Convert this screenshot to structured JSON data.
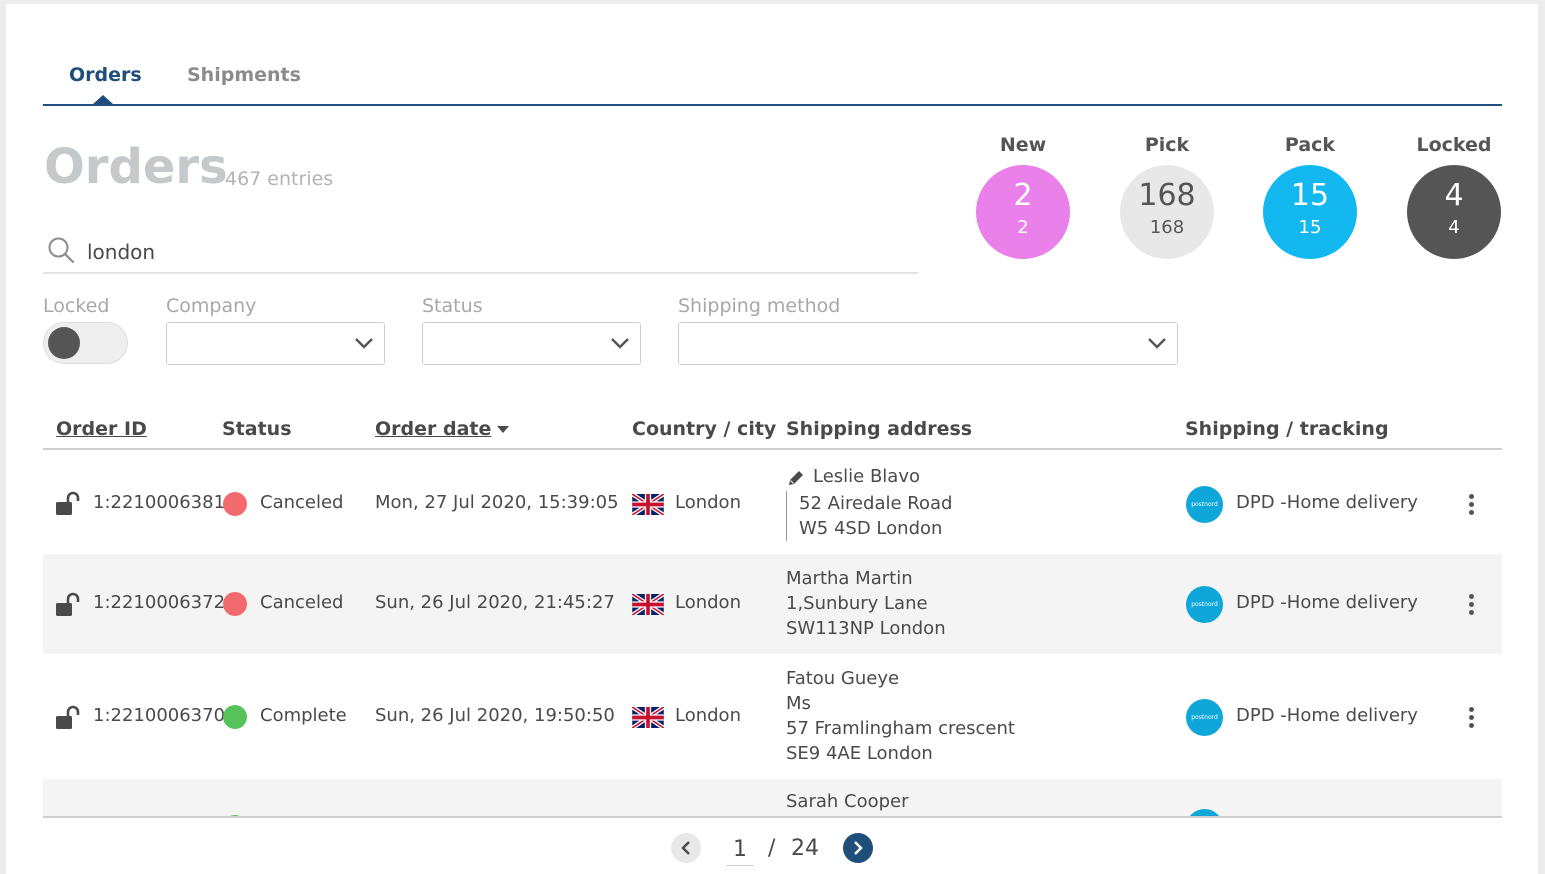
{
  "tabs": [
    {
      "label": "Orders",
      "active": true
    },
    {
      "label": "Shipments",
      "active": false
    }
  ],
  "title": "Orders",
  "entries": "467 entries",
  "search": {
    "value": "london",
    "placeholder": ""
  },
  "counters": [
    {
      "label": "New",
      "big": "2",
      "small": "2",
      "color": "#ea80ea"
    },
    {
      "label": "Pick",
      "big": "168",
      "small": "168",
      "color": "#e8e8e8"
    },
    {
      "label": "Pack",
      "big": "15",
      "small": "15",
      "color": "#12b8ef"
    },
    {
      "label": "Locked",
      "big": "4",
      "small": "4",
      "color": "#555555"
    }
  ],
  "filters": {
    "locked_label": "Locked",
    "locked_on": false,
    "company_label": "Company",
    "company_value": "",
    "status_label": "Status",
    "status_value": "",
    "shipping_method_label": "Shipping method",
    "shipping_method_value": ""
  },
  "table": {
    "headers": {
      "order_id": "Order ID",
      "status": "Status",
      "order_date": "Order date",
      "country_city": "Country / city",
      "shipping_address": "Shipping address",
      "shipping_tracking": "Shipping / tracking"
    },
    "rows": [
      {
        "order_id": "1:2210006381",
        "status": "Canceled",
        "status_color": "#f26a6d",
        "date": "Mon, 27 Jul 2020, 15:39:05",
        "city": "London",
        "country_flag": "uk-flag-icon",
        "address": [
          "Leslie Blavo",
          "52 Airedale Road",
          "W5 4SD London"
        ],
        "address_edited": true,
        "carrier_logo": "postnord",
        "shipping": "DPD -Home delivery"
      },
      {
        "order_id": "1:2210006372",
        "status": "Canceled",
        "status_color": "#f26a6d",
        "date": "Sun, 26 Jul 2020, 21:45:27",
        "city": "London",
        "country_flag": "uk-flag-icon",
        "address": [
          "Martha Martin",
          "1,Sunbury Lane",
          "SW113NP London"
        ],
        "address_edited": false,
        "carrier_logo": "postnord",
        "shipping": "DPD -Home delivery"
      },
      {
        "order_id": "1:2210006370",
        "status": "Complete",
        "status_color": "#55c35a",
        "date": "Sun, 26 Jul 2020, 19:50:50",
        "city": "London",
        "country_flag": "uk-flag-icon",
        "address": [
          "Fatou Gueye",
          "Ms",
          "57 Framlingham crescent",
          "SE9 4AE London"
        ],
        "address_edited": false,
        "carrier_logo": "postnord",
        "shipping": "DPD -Home delivery"
      },
      {
        "order_id": "",
        "status": "",
        "status_color": "#55c35a",
        "date": "",
        "city": "",
        "country_flag": "uk-flag-icon",
        "address": [
          "Sarah Cooper"
        ],
        "address_edited": false,
        "carrier_logo": "",
        "shipping": ""
      }
    ]
  },
  "pagination": {
    "current": "1",
    "separator": "/",
    "total": "24"
  }
}
